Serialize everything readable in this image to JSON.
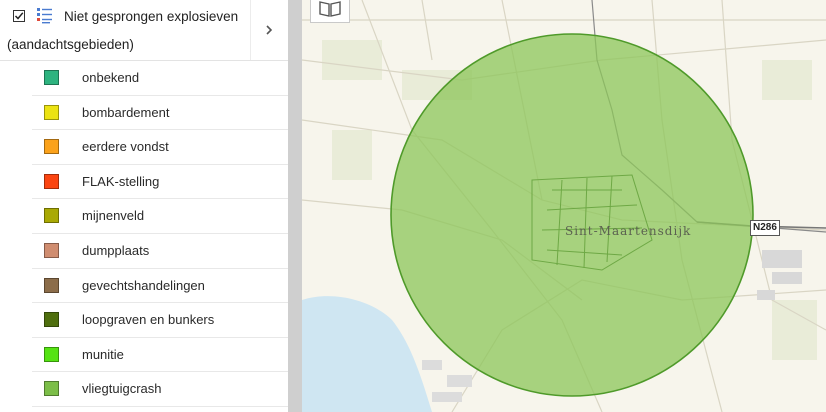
{
  "layer": {
    "title": "Niet gesprongen explosieven",
    "subtitle": "(aandachtsgebieden)",
    "checked": true
  },
  "legend": [
    {
      "label": "onbekend",
      "color": "#2db37f"
    },
    {
      "label": "bombardement",
      "color": "#ece313"
    },
    {
      "label": "eerdere vondst",
      "color": "#fba21b"
    },
    {
      "label": "FLAK-stelling",
      "color": "#fb4511"
    },
    {
      "label": "mijnenveld",
      "color": "#a9a904"
    },
    {
      "label": "dumpplaats",
      "color": "#d08d70"
    },
    {
      "label": "gevechtshandelingen",
      "color": "#8c6d4a"
    },
    {
      "label": "loopgraven en bunkers",
      "color": "#4f6f0e"
    },
    {
      "label": "munitie",
      "color": "#55e313"
    },
    {
      "label": "vliegtuigcrash",
      "color": "#7cbe48"
    }
  ],
  "map": {
    "place_name": "Sint-Maartensdijk",
    "road_label": "N286",
    "area_color": "#8cc65a",
    "water_color": "#cfe6f2"
  }
}
